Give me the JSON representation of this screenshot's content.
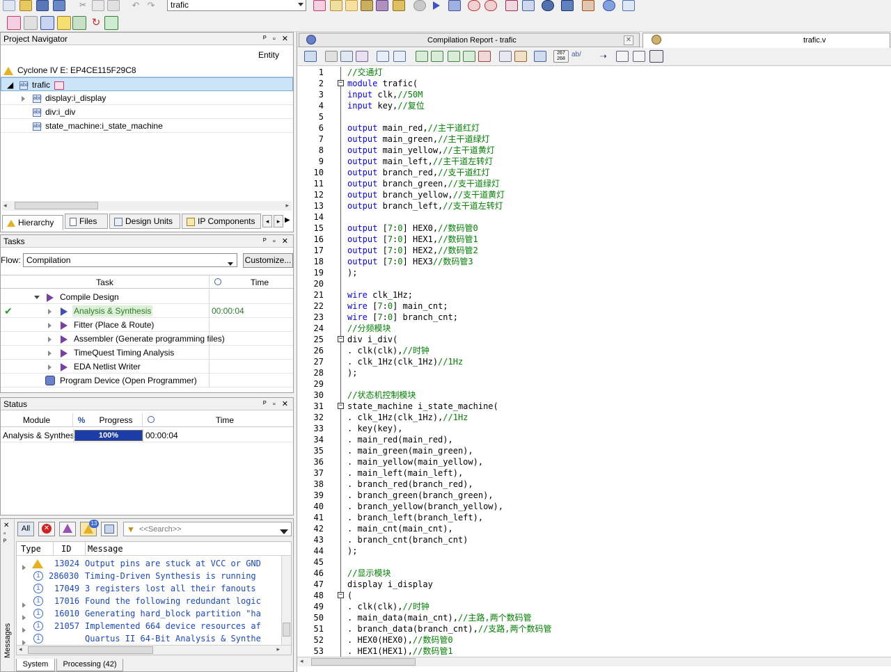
{
  "toolbar": {
    "project_select": "trafic"
  },
  "navigator": {
    "title": "Project Navigator",
    "entity_header": "Entity",
    "device": "Cyclone IV E: EP4CE115F29C8",
    "items": [
      {
        "label": "trafic"
      },
      {
        "label": "display:i_display"
      },
      {
        "label": "div:i_div"
      },
      {
        "label": "state_machine:i_state_machine"
      }
    ],
    "tabs": [
      "Hierarchy",
      "Files",
      "Design Units",
      "IP Components"
    ]
  },
  "tasks": {
    "title": "Tasks",
    "flow_label": "Flow:",
    "flow_value": "Compilation",
    "customize_label": "Customize...",
    "col_task": "Task",
    "col_time": "Time",
    "rows": [
      {
        "label": "Compile Design",
        "time": ""
      },
      {
        "label": "Analysis & Synthesis",
        "time": "00:00:04"
      },
      {
        "label": "Fitter (Place & Route)",
        "time": ""
      },
      {
        "label": "Assembler (Generate programming files)",
        "time": ""
      },
      {
        "label": "TimeQuest Timing Analysis",
        "time": ""
      },
      {
        "label": "EDA Netlist Writer",
        "time": ""
      },
      {
        "label": "Program Device (Open Programmer)",
        "time": ""
      }
    ]
  },
  "status": {
    "title": "Status",
    "col_module": "Module",
    "col_pct": "%",
    "col_progress": "Progress",
    "col_time": "Time",
    "row_module": "Analysis & Synthesis",
    "row_progress_text": "100%",
    "row_progress": 1.0,
    "row_time": "00:00:04"
  },
  "messages": {
    "all_label": "All",
    "warning_count": "13",
    "search_placeholder": "<<Search>>",
    "col_type": "Type",
    "col_id": "ID",
    "col_message": "Message",
    "side_label": "Messages",
    "rows": [
      {
        "id": "13024",
        "text": "Output pins are stuck at VCC or GND"
      },
      {
        "id": "286030",
        "text": "Timing-Driven Synthesis is running"
      },
      {
        "id": "17049",
        "text": "3 registers lost all their fanouts"
      },
      {
        "id": "17016",
        "text": "Found the following redundant logic"
      },
      {
        "id": "16010",
        "text": "Generating hard_block partition \"ha"
      },
      {
        "id": "21057",
        "text": "Implemented 664 device resources af"
      },
      {
        "id": "",
        "text": "Quartus II 64-Bit Analysis & Synthe"
      }
    ],
    "tabs": [
      "System",
      "Processing (42)"
    ]
  },
  "editor": {
    "tab_report": "Compilation Report - trafic",
    "tab_file": "trafic.v"
  },
  "code": [
    {
      "n": "1",
      "segs": [
        [
          "cm",
          "//交通灯"
        ]
      ]
    },
    {
      "n": "2",
      "fold": true,
      "segs": [
        [
          "kw",
          "module"
        ],
        [
          "",
          " trafic("
        ]
      ]
    },
    {
      "n": "3",
      "segs": [
        [
          "kw",
          "input"
        ],
        [
          "",
          " clk,"
        ],
        [
          "cm",
          "//50M"
        ]
      ]
    },
    {
      "n": "4",
      "segs": [
        [
          "kw",
          "input"
        ],
        [
          "",
          " key,"
        ],
        [
          "cm",
          "//复位"
        ]
      ]
    },
    {
      "n": "5",
      "segs": []
    },
    {
      "n": "6",
      "segs": [
        [
          "kw",
          "output"
        ],
        [
          "",
          " main_red,"
        ],
        [
          "cm",
          "//主干道红灯"
        ]
      ]
    },
    {
      "n": "7",
      "segs": [
        [
          "kw",
          "output"
        ],
        [
          "",
          " main_green,"
        ],
        [
          "cm",
          "//主干道绿灯"
        ]
      ]
    },
    {
      "n": "8",
      "segs": [
        [
          "kw",
          "output"
        ],
        [
          "",
          " main_yellow,"
        ],
        [
          "cm",
          "//主干道黄灯"
        ]
      ]
    },
    {
      "n": "9",
      "segs": [
        [
          "kw",
          "output"
        ],
        [
          "",
          " main_left,"
        ],
        [
          "cm",
          "//主干道左转灯"
        ]
      ]
    },
    {
      "n": "10",
      "segs": [
        [
          "kw",
          "output"
        ],
        [
          "",
          " branch_red,"
        ],
        [
          "cm",
          "//支干道红灯"
        ]
      ]
    },
    {
      "n": "11",
      "segs": [
        [
          "kw",
          "output"
        ],
        [
          "",
          " branch_green,"
        ],
        [
          "cm",
          "//支干道绿灯"
        ]
      ]
    },
    {
      "n": "12",
      "segs": [
        [
          "kw",
          "output"
        ],
        [
          "",
          " branch_yellow,"
        ],
        [
          "cm",
          "//支干道黄灯"
        ]
      ]
    },
    {
      "n": "13",
      "segs": [
        [
          "kw",
          "output"
        ],
        [
          "",
          " branch_left,"
        ],
        [
          "cm",
          "//支干道左转灯"
        ]
      ]
    },
    {
      "n": "14",
      "segs": []
    },
    {
      "n": "15",
      "segs": [
        [
          "kw",
          "output"
        ],
        [
          "",
          " ["
        ],
        [
          "nm",
          "7"
        ],
        [
          "",
          ":"
        ],
        [
          "nm",
          "0"
        ],
        [
          "",
          "] HEX0,"
        ],
        [
          "cm",
          "//数码管0"
        ]
      ]
    },
    {
      "n": "16",
      "segs": [
        [
          "kw",
          "output"
        ],
        [
          "",
          " ["
        ],
        [
          "nm",
          "7"
        ],
        [
          "",
          ":"
        ],
        [
          "nm",
          "0"
        ],
        [
          "",
          "] HEX1,"
        ],
        [
          "cm",
          "//数码管1"
        ]
      ]
    },
    {
      "n": "17",
      "segs": [
        [
          "kw",
          "output"
        ],
        [
          "",
          " ["
        ],
        [
          "nm",
          "7"
        ],
        [
          "",
          ":"
        ],
        [
          "nm",
          "0"
        ],
        [
          "",
          "] HEX2,"
        ],
        [
          "cm",
          "//数码管2"
        ]
      ]
    },
    {
      "n": "18",
      "segs": [
        [
          "kw",
          "output"
        ],
        [
          "",
          " ["
        ],
        [
          "nm",
          "7"
        ],
        [
          "",
          ":"
        ],
        [
          "nm",
          "0"
        ],
        [
          "",
          "] HEX3"
        ],
        [
          "cm",
          "//数码管3"
        ]
      ]
    },
    {
      "n": "19",
      "segs": [
        [
          "",
          ");"
        ]
      ]
    },
    {
      "n": "20",
      "segs": []
    },
    {
      "n": "21",
      "segs": [
        [
          "kw",
          "wire"
        ],
        [
          "",
          " clk_1Hz;"
        ]
      ]
    },
    {
      "n": "22",
      "segs": [
        [
          "kw",
          "wire"
        ],
        [
          "",
          " ["
        ],
        [
          "nm",
          "7"
        ],
        [
          "",
          ":"
        ],
        [
          "nm",
          "0"
        ],
        [
          "",
          "] main_cnt;"
        ]
      ]
    },
    {
      "n": "23",
      "segs": [
        [
          "kw",
          "wire"
        ],
        [
          "",
          " ["
        ],
        [
          "nm",
          "7"
        ],
        [
          "",
          ":"
        ],
        [
          "nm",
          "0"
        ],
        [
          "",
          "] branch_cnt;"
        ]
      ]
    },
    {
      "n": "24",
      "segs": [
        [
          "cm",
          "//分频模块"
        ]
      ]
    },
    {
      "n": "25",
      "fold": true,
      "segs": [
        [
          "",
          "div i_div("
        ]
      ]
    },
    {
      "n": "26",
      "segs": [
        [
          "",
          ". clk(clk),"
        ],
        [
          "cm",
          "//时钟"
        ]
      ]
    },
    {
      "n": "27",
      "segs": [
        [
          "",
          ". clk_1Hz(clk_1Hz)"
        ],
        [
          "cm",
          "//1Hz"
        ]
      ]
    },
    {
      "n": "28",
      "segs": [
        [
          "",
          ");"
        ]
      ]
    },
    {
      "n": "29",
      "segs": []
    },
    {
      "n": "30",
      "segs": [
        [
          "cm",
          "//状态机控制模块"
        ]
      ]
    },
    {
      "n": "31",
      "fold": true,
      "segs": [
        [
          "",
          "state_machine i_state_machine("
        ]
      ]
    },
    {
      "n": "32",
      "segs": [
        [
          "",
          ". clk_1Hz(clk_1Hz),"
        ],
        [
          "cm",
          "//1Hz"
        ]
      ]
    },
    {
      "n": "33",
      "segs": [
        [
          "",
          ". key(key),"
        ]
      ]
    },
    {
      "n": "34",
      "segs": [
        [
          "",
          ". main_red(main_red),"
        ]
      ]
    },
    {
      "n": "35",
      "segs": [
        [
          "",
          ". main_green(main_green),"
        ]
      ]
    },
    {
      "n": "36",
      "segs": [
        [
          "",
          ". main_yellow(main_yellow),"
        ]
      ]
    },
    {
      "n": "37",
      "segs": [
        [
          "",
          ". main_left(main_left),"
        ]
      ]
    },
    {
      "n": "38",
      "segs": [
        [
          "",
          ". branch_red(branch_red),"
        ]
      ]
    },
    {
      "n": "39",
      "segs": [
        [
          "",
          ". branch_green(branch_green),"
        ]
      ]
    },
    {
      "n": "40",
      "segs": [
        [
          "",
          ". branch_yellow(branch_yellow),"
        ]
      ]
    },
    {
      "n": "41",
      "segs": [
        [
          "",
          ". branch_left(branch_left),"
        ]
      ]
    },
    {
      "n": "42",
      "segs": [
        [
          "",
          ". main_cnt(main_cnt),"
        ]
      ]
    },
    {
      "n": "43",
      "segs": [
        [
          "",
          ". branch_cnt(branch_cnt)"
        ]
      ]
    },
    {
      "n": "44",
      "segs": [
        [
          "",
          ");"
        ]
      ]
    },
    {
      "n": "45",
      "segs": []
    },
    {
      "n": "46",
      "segs": [
        [
          "cm",
          "//显示模块"
        ]
      ]
    },
    {
      "n": "47",
      "segs": [
        [
          "",
          "display i_display"
        ]
      ]
    },
    {
      "n": "48",
      "fold": true,
      "segs": [
        [
          "",
          "("
        ]
      ]
    },
    {
      "n": "49",
      "segs": [
        [
          "",
          ". clk(clk),"
        ],
        [
          "cm",
          "//时钟"
        ]
      ]
    },
    {
      "n": "50",
      "segs": [
        [
          "",
          ". main_data(main_cnt),"
        ],
        [
          "cm",
          "//主路,两个数码管"
        ]
      ]
    },
    {
      "n": "51",
      "segs": [
        [
          "",
          ". branch_data(branch_cnt),"
        ],
        [
          "cm",
          "//支路,两个数码管"
        ]
      ]
    },
    {
      "n": "52",
      "segs": [
        [
          "",
          ". HEX0(HEX0),"
        ],
        [
          "cm",
          "//数码管0"
        ]
      ]
    },
    {
      "n": "53",
      "segs": [
        [
          "",
          ". HEX1(HEX1),"
        ],
        [
          "cm",
          "//数码管1"
        ]
      ]
    }
  ]
}
